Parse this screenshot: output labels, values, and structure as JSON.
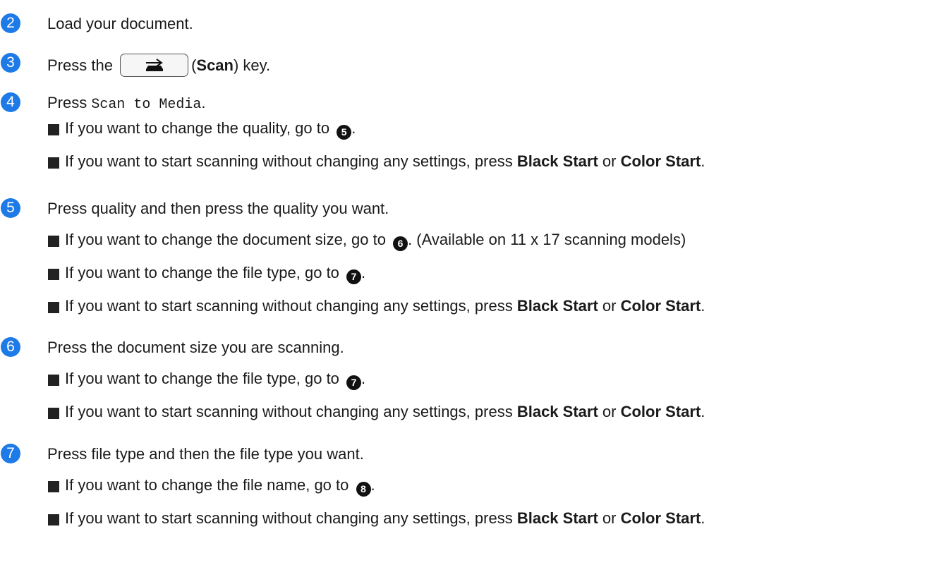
{
  "step_color": "#1d7ae6",
  "steps": [
    {
      "num": "2",
      "text": "Load your document."
    },
    {
      "num": "3",
      "pre": "Press the",
      "key_icon": "scan-key-icon",
      "paren_open": "(",
      "key_label": "Scan",
      "post": ") key."
    },
    {
      "num": "4",
      "pre": "Press",
      "code": "Scan to Media",
      "post": ".",
      "bullets": [
        {
          "pre": "If you want to change the quality, go to",
          "ref": "5",
          "post": "."
        },
        {
          "pre": "If you want to start scanning without changing any settings, press",
          "b1": "Black Start",
          "mid": "or",
          "b2": "Color Start",
          "post": "."
        }
      ]
    },
    {
      "num": "5",
      "text": "Press quality and then press the quality you want.",
      "bullets": [
        {
          "pre": "If you want to change the document size, go to",
          "ref": "6",
          "post": ". (Available on 11 x 17 scanning models)"
        },
        {
          "pre": "If you want to change the file type, go to",
          "ref": "7",
          "post": "."
        },
        {
          "pre": "If you want to start scanning without changing any settings, press",
          "b1": "Black Start",
          "mid": "or",
          "b2": "Color Start",
          "post": "."
        }
      ]
    },
    {
      "num": "6",
      "text": "Press the document size you are scanning.",
      "bullets": [
        {
          "pre": "If you want to change the file type, go to",
          "ref": "7",
          "post": "."
        },
        {
          "pre": "If you want to start scanning without changing any settings, press",
          "b1": "Black Start",
          "mid": "or",
          "b2": "Color Start",
          "post": "."
        }
      ]
    },
    {
      "num": "7",
      "text": "Press file type and then the file type you want.",
      "bullets": [
        {
          "pre": "If you want to change the file name, go to",
          "ref": "8",
          "post": "."
        },
        {
          "pre": "If you want to start scanning without changing any settings, press",
          "b1": "Black Start",
          "mid": "or",
          "b2": "Color Start",
          "post": "."
        }
      ]
    }
  ]
}
